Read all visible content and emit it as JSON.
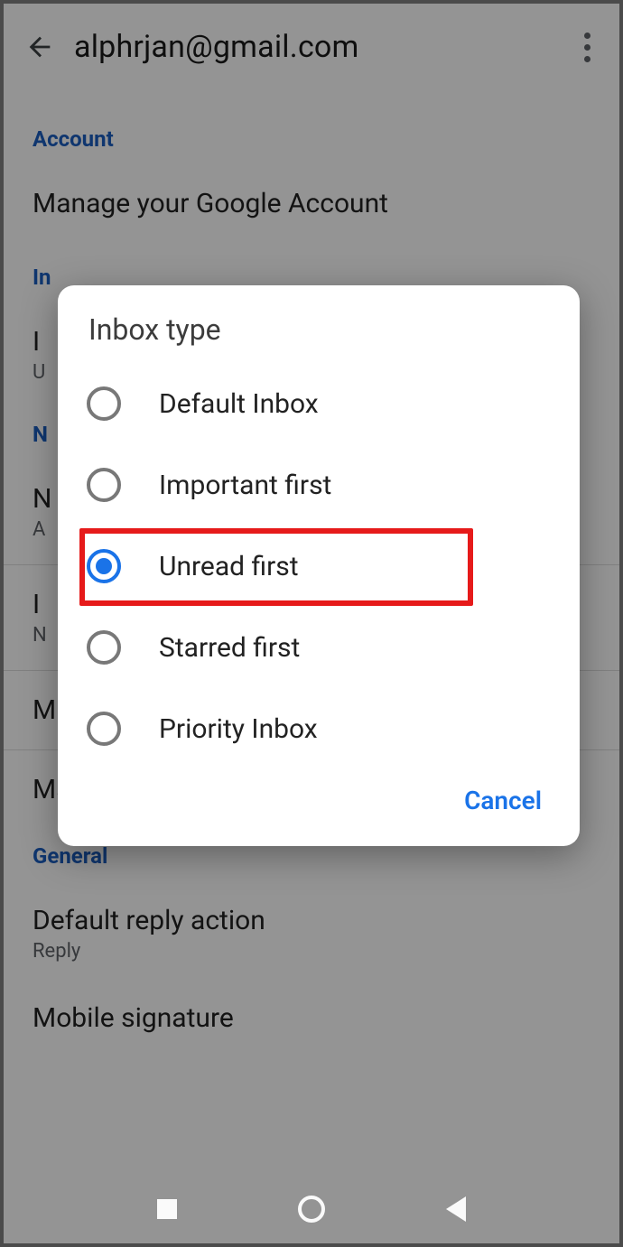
{
  "header": {
    "title": "alphrjan@gmail.com"
  },
  "sections": {
    "account": {
      "title": "Account",
      "items": [
        {
          "label": "Manage your Google Account"
        }
      ]
    },
    "inbox": {
      "title": "In",
      "items": [
        {
          "label": "I",
          "sub": "U"
        }
      ]
    },
    "notifications": {
      "title_initial": "N",
      "items": [
        {
          "label": "N",
          "sub": "A"
        },
        {
          "label": "I",
          "sub": "N"
        },
        {
          "label": "M"
        },
        {
          "label": "Manage notifications"
        }
      ]
    },
    "general": {
      "title": "General",
      "items": [
        {
          "label": "Default reply action",
          "sub": "Reply"
        },
        {
          "label": "Mobile signature"
        }
      ]
    }
  },
  "dialog": {
    "title": "Inbox type",
    "options": [
      {
        "label": "Default Inbox",
        "selected": false
      },
      {
        "label": "Important first",
        "selected": false
      },
      {
        "label": "Unread first",
        "selected": true
      },
      {
        "label": "Starred first",
        "selected": false
      },
      {
        "label": "Priority Inbox",
        "selected": false
      }
    ],
    "cancel_label": "Cancel"
  },
  "colors": {
    "accent": "#1a73e8",
    "section": "#1a5dc0",
    "highlight": "#e61a1a"
  }
}
